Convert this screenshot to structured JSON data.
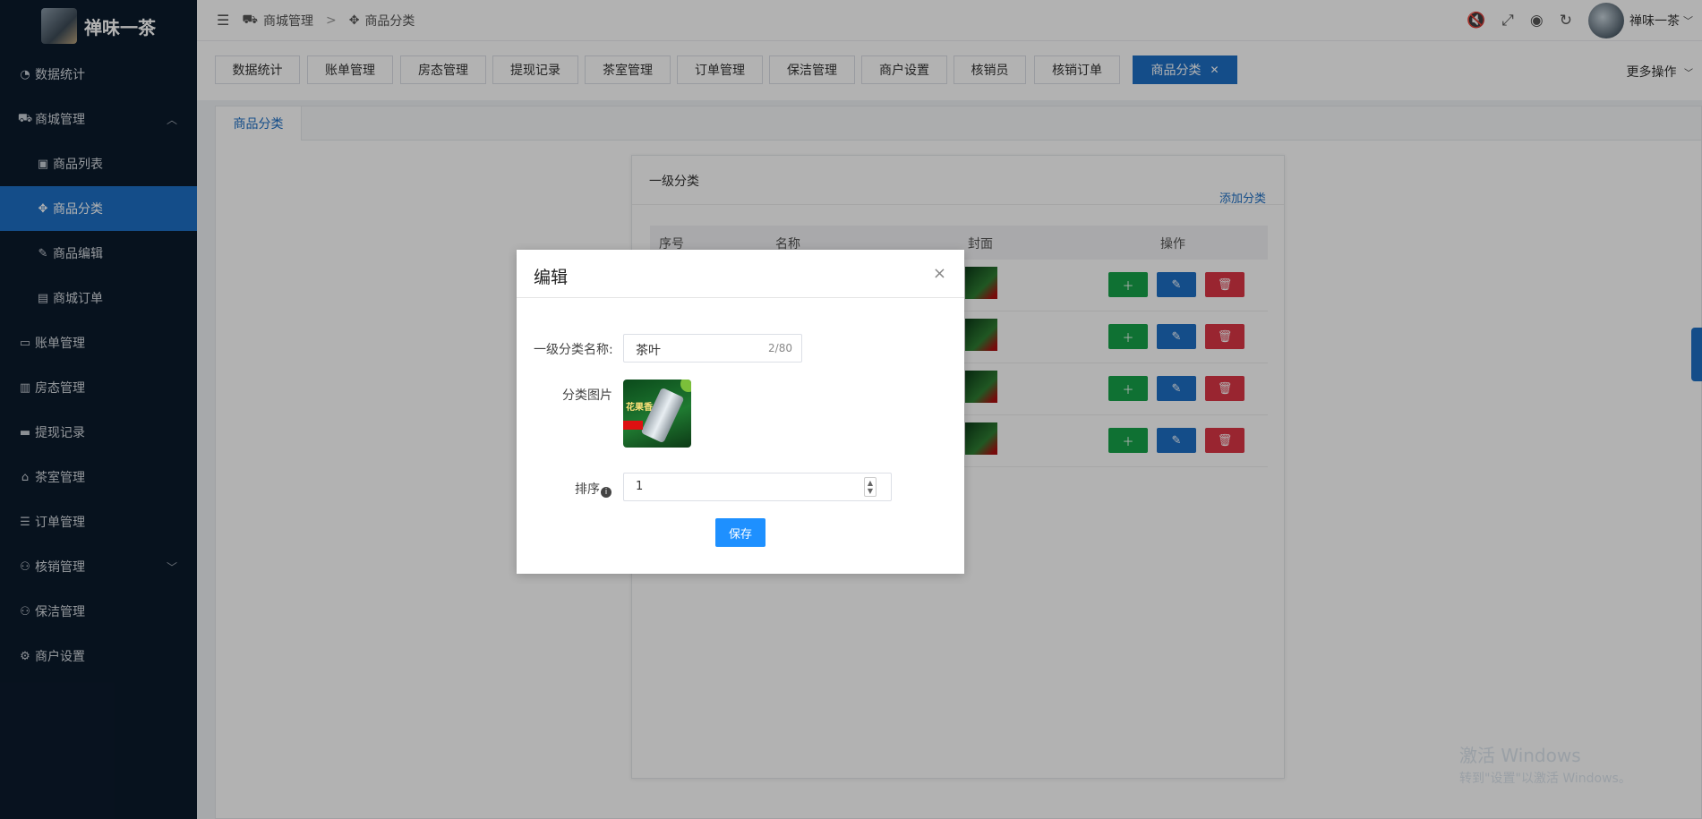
{
  "app": {
    "name": "禅味一茶"
  },
  "sidebar": {
    "items": [
      {
        "label": "数据统计",
        "icon": "dashboard-icon"
      },
      {
        "label": "商城管理",
        "icon": "shop-icon",
        "expanded": true
      },
      {
        "label": "商品列表",
        "icon": "bag-icon",
        "sub": true
      },
      {
        "label": "商品分类",
        "icon": "move-icon",
        "sub": true,
        "active": true
      },
      {
        "label": "商品编辑",
        "icon": "edit-icon",
        "sub": true
      },
      {
        "label": "商城订单",
        "icon": "store-icon",
        "sub": true
      },
      {
        "label": "账单管理",
        "icon": "bill-icon"
      },
      {
        "label": "房态管理",
        "icon": "chart-icon"
      },
      {
        "label": "提现记录",
        "icon": "money-icon"
      },
      {
        "label": "茶室管理",
        "icon": "home-icon"
      },
      {
        "label": "订单管理",
        "icon": "list-icon"
      },
      {
        "label": "核销管理",
        "icon": "user-check-icon",
        "expandable": true
      },
      {
        "label": "保洁管理",
        "icon": "user-clean-icon"
      },
      {
        "label": "商户设置",
        "icon": "gear-icon"
      }
    ]
  },
  "header": {
    "breadcrumb": [
      "商城管理",
      "商品分类"
    ],
    "username": "禅味一茶"
  },
  "tabs": [
    {
      "label": "数据统计"
    },
    {
      "label": "账单管理"
    },
    {
      "label": "房态管理"
    },
    {
      "label": "提现记录"
    },
    {
      "label": "茶室管理"
    },
    {
      "label": "订单管理"
    },
    {
      "label": "保洁管理"
    },
    {
      "label": "商户设置"
    },
    {
      "label": "核销员"
    },
    {
      "label": "核销订单"
    },
    {
      "label": "商品分类",
      "active": true,
      "closable": true
    }
  ],
  "more_ops": "更多操作",
  "content": {
    "tab": "商品分类",
    "panel_title": "一级分类",
    "add_link": "添加分类",
    "columns": [
      "序号",
      "名称",
      "封面",
      "操作"
    ],
    "row_count": 4
  },
  "modal": {
    "title": "编辑",
    "close": "×",
    "name_label": "一级分类名称:",
    "name_value": "茶叶",
    "name_counter": "2/80",
    "image_label": "分类图片",
    "image_text": "花果香",
    "sort_label": "排序",
    "sort_value": "1",
    "save": "保存"
  },
  "watermark": {
    "line1": "激活 Windows",
    "line2": "转到\"设置\"以激活 Windows。"
  },
  "colors": {
    "accent": "#1e6fc4",
    "sidebar": "#0b1a2c",
    "green": "#16a34a",
    "red": "#dc3545"
  }
}
